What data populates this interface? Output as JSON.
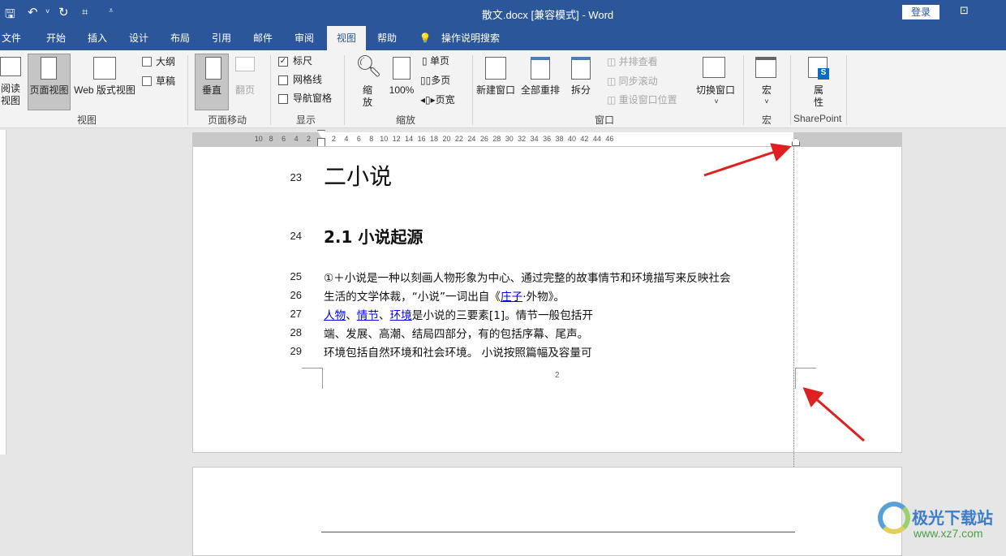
{
  "window": {
    "title": "散文.docx [兼容模式]  -  Word",
    "login": "登录"
  },
  "tabs": [
    "文件",
    "开始",
    "插入",
    "设计",
    "布局",
    "引用",
    "邮件",
    "审阅",
    "视图",
    "帮助"
  ],
  "active_tab": "视图",
  "tell_me": "操作说明搜索",
  "ribbon": {
    "view": {
      "label": "视图",
      "read_mode": "阅读视图",
      "print_layout": "页面视图",
      "web_layout": "Web 版式视图",
      "outline": "大纲",
      "draft": "草稿"
    },
    "page_movement": {
      "label": "页面移动",
      "vertical": "垂直",
      "side_to_side": "翻页"
    },
    "show": {
      "label": "显示",
      "ruler": "标尺",
      "gridlines": "网格线",
      "nav_pane": "导航窗格",
      "ruler_checked": true,
      "gridlines_checked": false,
      "nav_pane_checked": false
    },
    "zoom": {
      "label": "缩放",
      "zoom": "缩放",
      "hundred": "100%",
      "one_page": "单页",
      "multiple_pages": "多页",
      "page_width": "页宽"
    },
    "window": {
      "label": "窗口",
      "new_window": "新建窗口",
      "arrange_all": "全部重排",
      "split": "拆分",
      "side_by_side": "并排查看",
      "sync_scroll": "同步滚动",
      "reset_pos": "重设窗口位置",
      "switch_windows": "切换窗口"
    },
    "macros": {
      "label": "宏",
      "macros": "宏"
    },
    "sharepoint": {
      "label": "SharePoint",
      "properties": "属性"
    }
  },
  "ruler": {
    "left": [
      "10",
      "8",
      "6",
      "4",
      "2"
    ],
    "right": [
      "2",
      "4",
      "6",
      "8",
      "10",
      "12",
      "14",
      "16",
      "18",
      "20",
      "22",
      "24",
      "26",
      "28",
      "30",
      "32",
      "34",
      "36",
      "38",
      "40",
      "42",
      "44",
      "46"
    ]
  },
  "document": {
    "lines": [
      {
        "n": "23",
        "text": "二小说"
      },
      {
        "n": "24",
        "text": "2.1 小说起源"
      },
      {
        "n": "25",
        "text": "①＋小说是一种以刻画人物形象为中心、通过完整的故事情节和环境描写来反映社会"
      },
      {
        "n": "26",
        "pre": "生活的文学体裁，“小说”一词出自《",
        "link": "庄子",
        "post": "·外物》。"
      },
      {
        "n": "27",
        "links": [
          "人物",
          "情节",
          "环境"
        ],
        "sep": "、",
        "post": "是小说的三要素[1]。情节一般包括开"
      },
      {
        "n": "28",
        "text": "端、发展、高潮、结局四部分，有的包括序幕、尾声。"
      },
      {
        "n": "29",
        "text": "环境包括自然环境和社会环境。 小说按照篇幅及容量可"
      }
    ],
    "page_number": "2"
  },
  "watermark": {
    "name": "极光下载站",
    "url": "www.xz7.com"
  },
  "colors": {
    "accent": "#2b579a",
    "arrow": "#e02020",
    "link": "#0000ee"
  }
}
